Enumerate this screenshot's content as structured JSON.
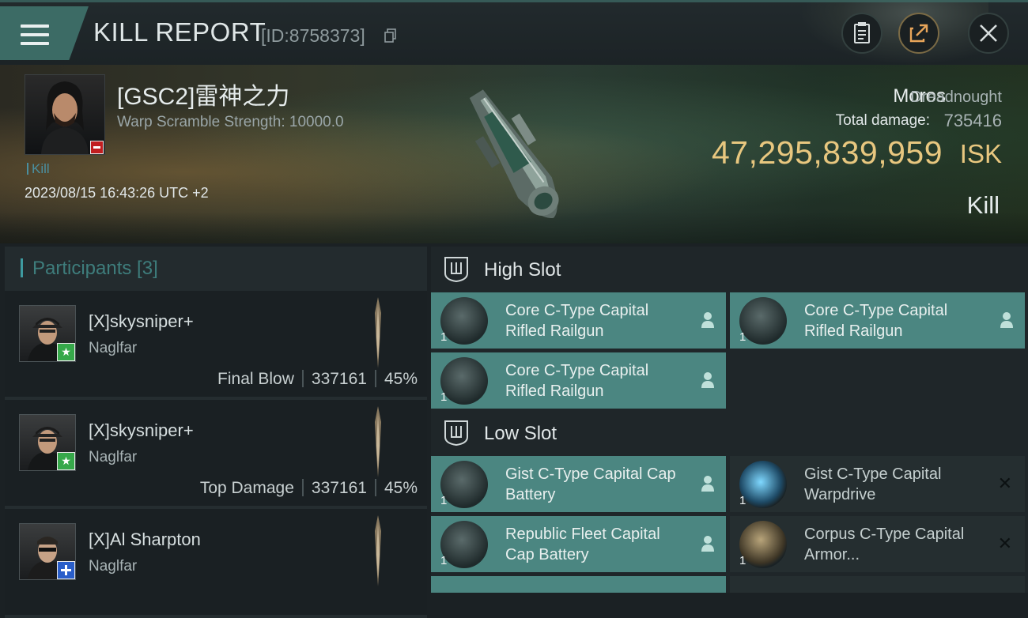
{
  "header": {
    "title": "KILL REPORT",
    "id_text": "[ID:8758373]",
    "menu_icon": "hamburger-icon",
    "buttons": [
      "clipboard-icon",
      "share-icon",
      "close-icon"
    ],
    "colors": {
      "accent": "#3c6b65",
      "gold": "#e8c77f"
    }
  },
  "victim": {
    "name": "[GSC2]雷神之力",
    "warp_scramble": "Warp Scramble Strength: 10000.0",
    "kill_tag": "Kill",
    "timestamp": "2023/08/15 16:43:26 UTC +2",
    "ship_name": "Moros",
    "ship_class": "Dreadnought",
    "total_damage_label": "Total damage:",
    "total_damage": "735416",
    "isk_value": "47,295,839,959",
    "isk_unit": "ISK",
    "result": "Kill"
  },
  "participants": {
    "title": "Participants [3]",
    "rows": [
      {
        "name": "[X]skysniper+",
        "ship": "Naglfar",
        "role": "Final Blow",
        "damage": "337161",
        "percent": "45%",
        "badge": "star"
      },
      {
        "name": "[X]skysniper+",
        "ship": "Naglfar",
        "role": "Top Damage",
        "damage": "337161",
        "percent": "45%",
        "badge": "star"
      },
      {
        "name": "[X]Al Sharpton",
        "ship": "Naglfar",
        "role": "",
        "damage": "",
        "percent": "",
        "badge": "plus"
      }
    ]
  },
  "fitting": {
    "high_slot": {
      "title": "High Slot",
      "modules": [
        {
          "name": "Core C-Type Capital Rifled Railgun",
          "qty": "1",
          "state": "fitted"
        },
        {
          "name": "Core C-Type Capital Rifled Railgun",
          "qty": "1",
          "state": "fitted"
        },
        {
          "name": "Core C-Type Capital Rifled Railgun",
          "qty": "1",
          "state": "fitted"
        }
      ]
    },
    "low_slot": {
      "title": "Low Slot",
      "modules": [
        {
          "name": "Gist C-Type Capital Cap Battery",
          "qty": "1",
          "state": "fitted"
        },
        {
          "name": "Gist C-Type Capital Warpdrive",
          "qty": "1",
          "state": "destroyed"
        },
        {
          "name": "Republic Fleet Capital Cap Battery",
          "qty": "1",
          "state": "fitted"
        },
        {
          "name": "Corpus C-Type Capital Armor...",
          "qty": "1",
          "state": "destroyed"
        }
      ]
    }
  }
}
